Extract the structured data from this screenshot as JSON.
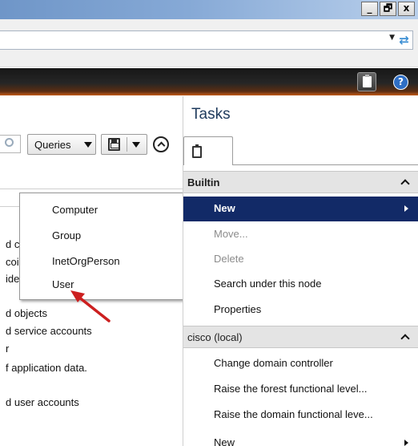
{
  "window": {
    "buttons": [
      {
        "label": "_"
      },
      {
        "label": "🗗"
      },
      {
        "label": "x"
      }
    ]
  },
  "toolbar": {
    "queries_label": "Queries"
  },
  "left_pane": {
    "fragments": [
      "d c",
      "coi",
      "ide",
      "d objects",
      "d service accounts",
      "r",
      "f application data.",
      "d user accounts"
    ]
  },
  "context_menu": {
    "items": [
      "Computer",
      "Group",
      "InetOrgPerson",
      "User"
    ]
  },
  "tasks": {
    "title": "Tasks",
    "sections": [
      {
        "label": "Builtin",
        "actions": [
          {
            "label": "New",
            "state": "selected"
          },
          {
            "label": "Move...",
            "state": "disabled"
          },
          {
            "label": "Delete",
            "state": "disabled"
          },
          {
            "label": "Search under this node",
            "state": "normal"
          },
          {
            "label": "Properties",
            "state": "normal"
          }
        ]
      },
      {
        "label": "cisco (local)",
        "actions": [
          {
            "label": "Change domain controller",
            "state": "normal"
          },
          {
            "label": "Raise the forest functional level...",
            "state": "normal"
          },
          {
            "label": "Raise the domain functional leve...",
            "state": "normal"
          },
          {
            "label": "New",
            "state": "normal"
          }
        ]
      }
    ]
  },
  "colors": {
    "selection": "#122a67",
    "arrow": "#cc1f1f",
    "title": "#1e3a5c"
  }
}
